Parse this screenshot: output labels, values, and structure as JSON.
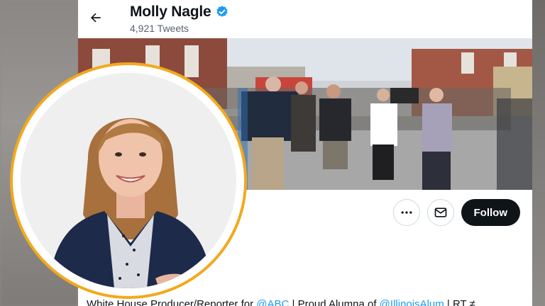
{
  "header": {
    "display_name": "Molly Nagle",
    "tweet_count": "4,921 Tweets"
  },
  "icons": {
    "back": "arrow-left-icon",
    "verified": "verified-badge-icon",
    "more": "more-horizontal-icon",
    "message": "envelope-icon"
  },
  "actions": {
    "follow_label": "Follow"
  },
  "bio": {
    "text_start": "White House Producer/Reporter for ",
    "link_1": "@ABC",
    "text_mid": " | Proud Alumna of ",
    "link_2": "@IllinoisAlum",
    "text_end": " | RT ≠"
  },
  "colors": {
    "accent": "#1d9bf0",
    "follow_bg": "#0f1419",
    "avatar_ring": "#f2a91f"
  }
}
